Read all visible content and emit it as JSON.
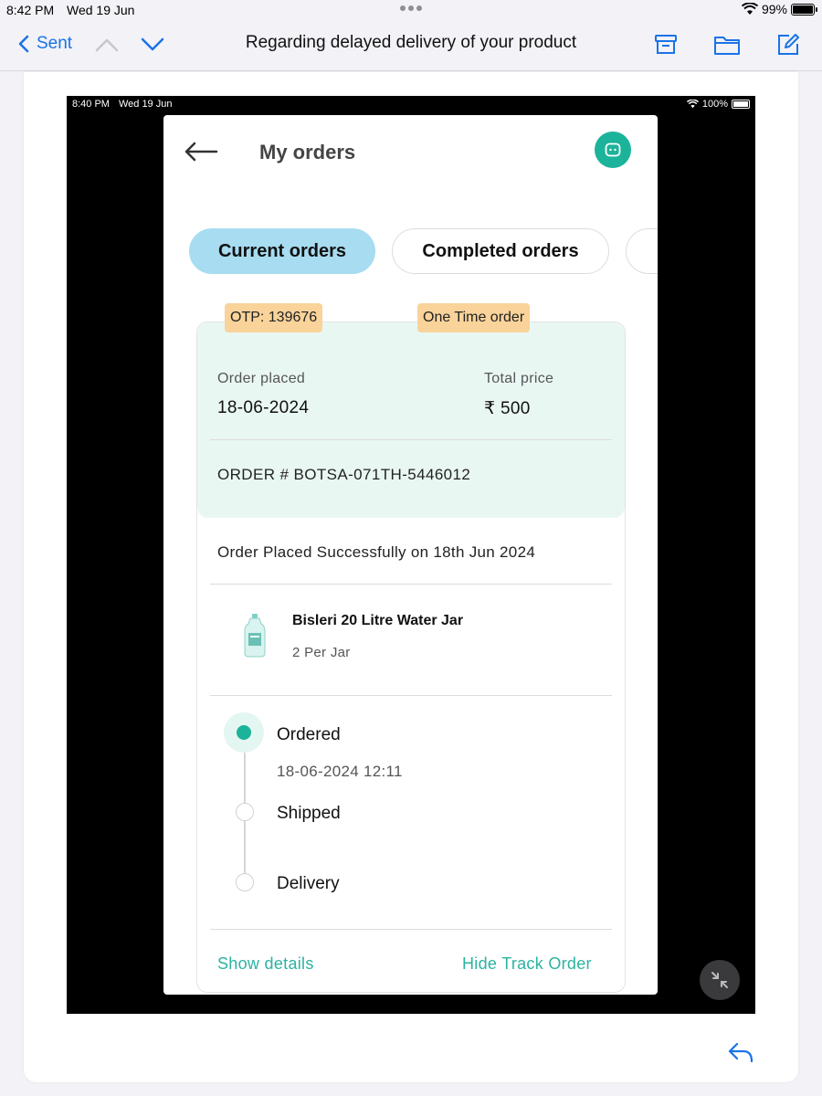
{
  "device_status": {
    "time": "8:42 PM",
    "date": "Wed 19 Jun",
    "battery": "99%"
  },
  "mail_nav": {
    "back_label": "Sent",
    "subject": "Regarding delayed delivery of your product"
  },
  "screenshot_status": {
    "time": "8:40 PM",
    "date": "Wed 19 Jun",
    "battery": "100%"
  },
  "app": {
    "title": "My orders",
    "tabs": [
      {
        "label": "Current orders",
        "active": true
      },
      {
        "label": "Completed orders",
        "active": false
      }
    ],
    "order": {
      "otp": "OTP: 139676",
      "order_type": "One Time order",
      "placed_label": "Order placed",
      "placed_value": "18-06-2024",
      "price_label": "Total price",
      "price_value": "₹ 500",
      "order_number": "ORDER # BOTSA-071TH-5446012",
      "status_message": "Order Placed Successfully on 18th Jun 2024",
      "product": {
        "name": "Bisleri 20 Litre Water Jar",
        "quantity": "2 Per Jar"
      },
      "timeline": [
        {
          "label": "Ordered",
          "time": "18-06-2024 12:11",
          "done": true
        },
        {
          "label": "Shipped",
          "done": false
        },
        {
          "label": "Delivery",
          "done": false
        }
      ],
      "show_details_label": "Show details",
      "hide_track_label": "Hide Track Order"
    },
    "accent_color": "#1bb39a",
    "active_tab_color": "#a7dcf1",
    "badge_color": "#f9d39a"
  }
}
